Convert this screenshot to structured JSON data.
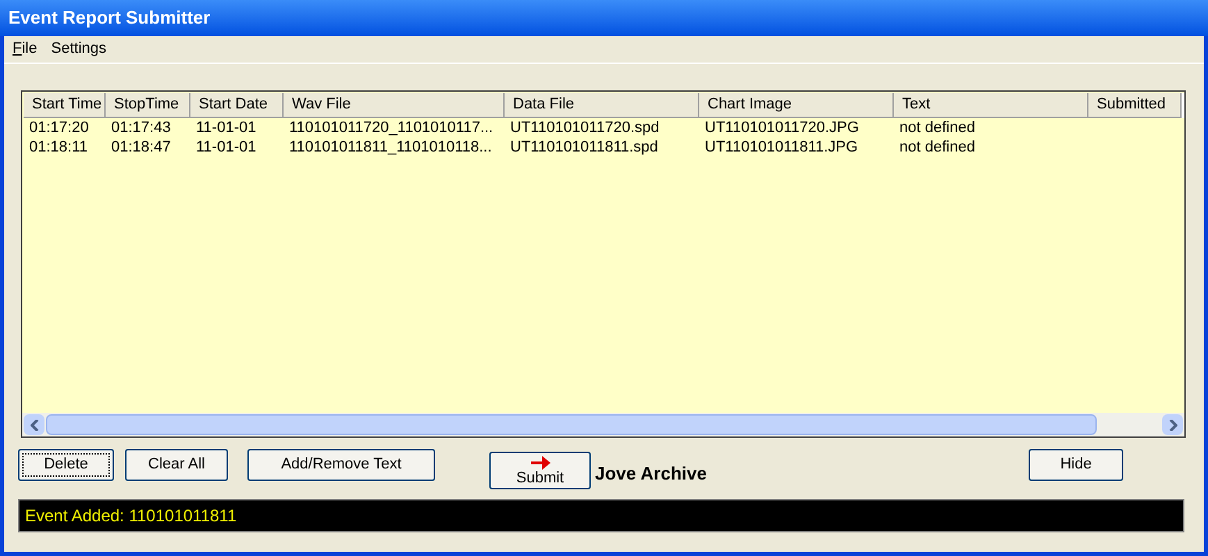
{
  "window": {
    "title": "Event Report Submitter"
  },
  "menu": [
    {
      "label": "File",
      "underlined": true
    },
    {
      "label": "Settings",
      "underlined": false
    }
  ],
  "table": {
    "columns": [
      "Start Time",
      "StopTime",
      "Start Date",
      "Wav File",
      "Data File",
      "Chart Image",
      "Text",
      "Submitted"
    ],
    "rows": [
      [
        "01:17:20",
        "01:17:43",
        "11-01-01",
        "110101011720_1101010117...",
        "UT110101011720.spd",
        "UT110101011720.JPG",
        "not defined",
        ""
      ],
      [
        "01:18:11",
        "01:18:47",
        "11-01-01",
        "110101011811_1101010118...",
        "UT110101011811.spd",
        "UT110101011811.JPG",
        "not defined",
        ""
      ]
    ]
  },
  "buttons": [
    {
      "label": "Delete",
      "focused": true
    },
    {
      "label": "Clear All",
      "focused": false
    },
    {
      "label": "Add/Remove Text",
      "focused": false
    }
  ],
  "submit": {
    "label": "Submit",
    "caption": "Jove Archive"
  },
  "hide_button": {
    "label": "Hide"
  },
  "status": "Event Added: 110101011811"
}
